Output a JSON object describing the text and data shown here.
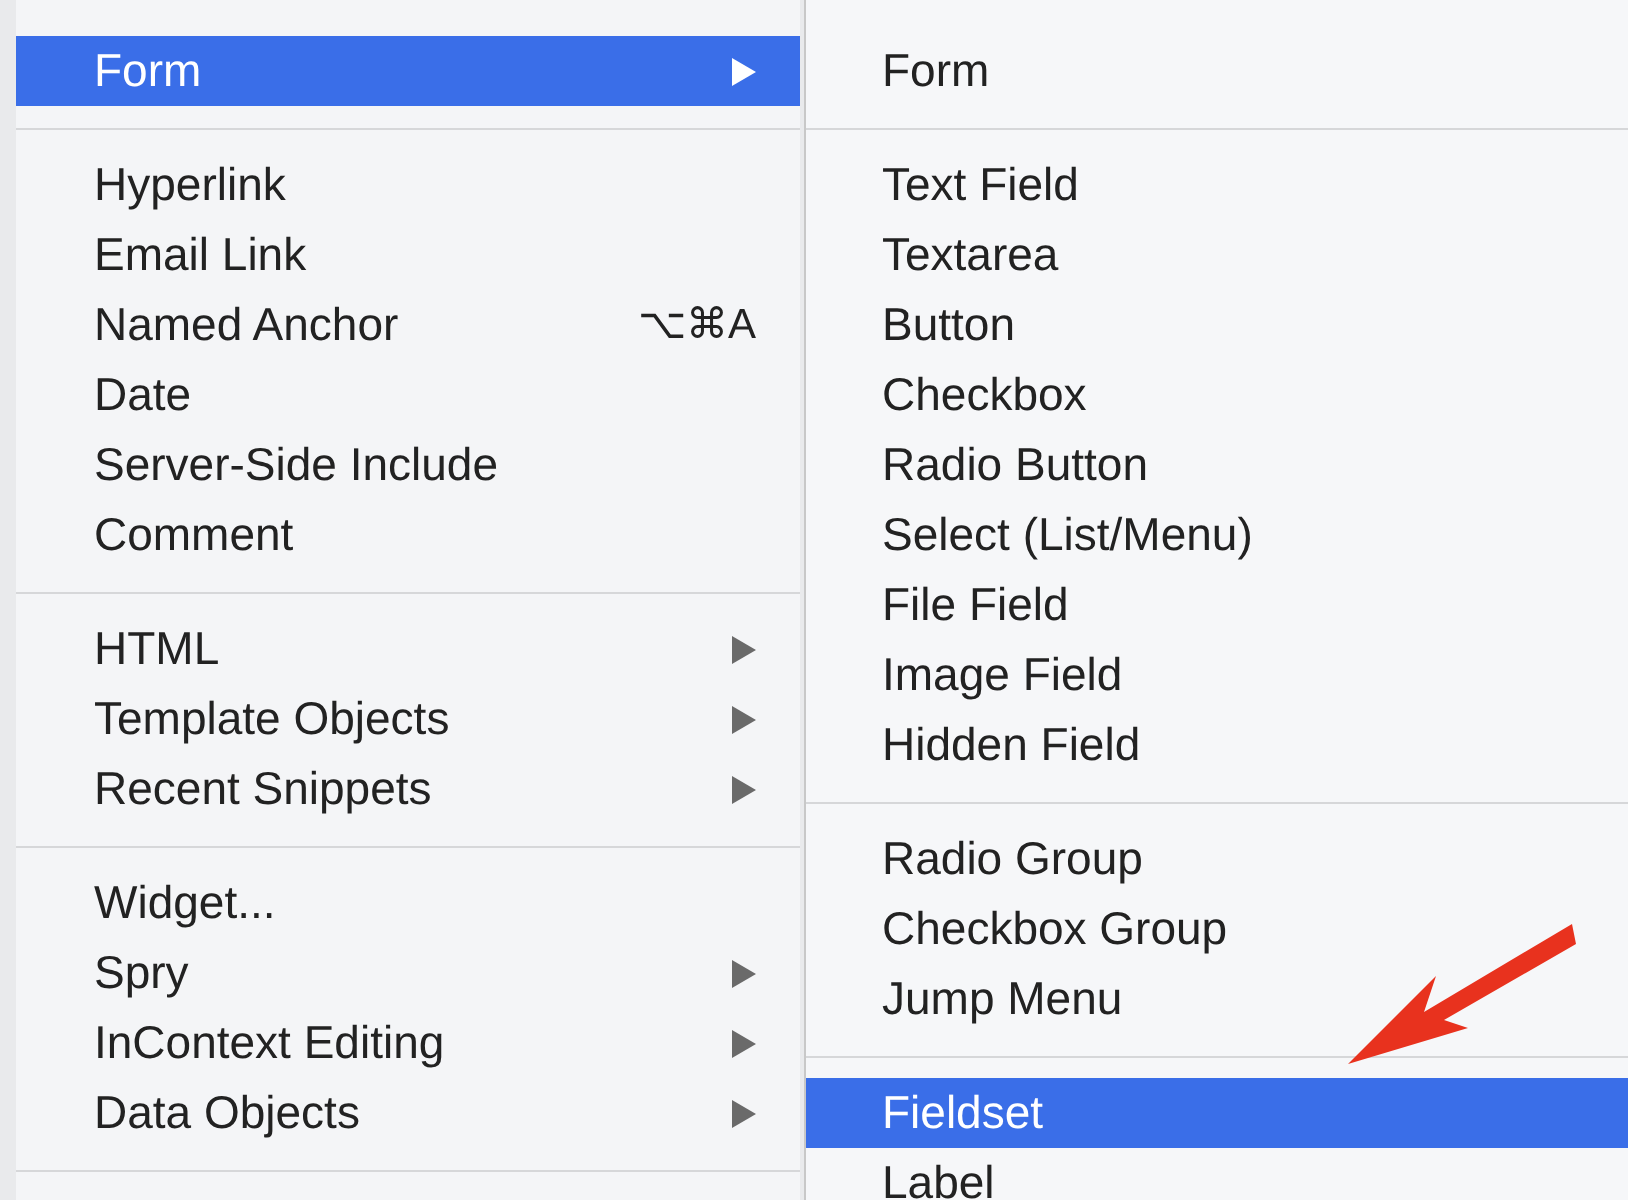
{
  "menu": {
    "items": [
      {
        "kind": "item",
        "label": "Form",
        "selected": true,
        "has_submenu": true
      },
      {
        "kind": "separator"
      },
      {
        "kind": "item",
        "label": "Hyperlink",
        "selected": false,
        "has_submenu": false
      },
      {
        "kind": "item",
        "label": "Email Link",
        "selected": false,
        "has_submenu": false
      },
      {
        "kind": "item",
        "label": "Named Anchor",
        "shortcut": "⌥⌘A",
        "selected": false,
        "has_submenu": false
      },
      {
        "kind": "item",
        "label": "Date",
        "selected": false,
        "has_submenu": false
      },
      {
        "kind": "item",
        "label": "Server-Side Include",
        "selected": false,
        "has_submenu": false
      },
      {
        "kind": "item",
        "label": "Comment",
        "selected": false,
        "has_submenu": false
      },
      {
        "kind": "separator"
      },
      {
        "kind": "item",
        "label": "HTML",
        "selected": false,
        "has_submenu": true
      },
      {
        "kind": "item",
        "label": "Template Objects",
        "selected": false,
        "has_submenu": true
      },
      {
        "kind": "item",
        "label": "Recent Snippets",
        "selected": false,
        "has_submenu": true
      },
      {
        "kind": "separator"
      },
      {
        "kind": "item",
        "label": "Widget...",
        "selected": false,
        "has_submenu": false
      },
      {
        "kind": "item",
        "label": "Spry",
        "selected": false,
        "has_submenu": true
      },
      {
        "kind": "item",
        "label": "InContext Editing",
        "selected": false,
        "has_submenu": true
      },
      {
        "kind": "item",
        "label": "Data Objects",
        "selected": false,
        "has_submenu": true
      },
      {
        "kind": "separator"
      }
    ]
  },
  "submenu": {
    "items": [
      {
        "kind": "item",
        "label": "Form",
        "selected": false
      },
      {
        "kind": "separator"
      },
      {
        "kind": "item",
        "label": "Text Field",
        "selected": false
      },
      {
        "kind": "item",
        "label": "Textarea",
        "selected": false
      },
      {
        "kind": "item",
        "label": "Button",
        "selected": false
      },
      {
        "kind": "item",
        "label": "Checkbox",
        "selected": false
      },
      {
        "kind": "item",
        "label": "Radio Button",
        "selected": false
      },
      {
        "kind": "item",
        "label": "Select (List/Menu)",
        "selected": false
      },
      {
        "kind": "item",
        "label": "File Field",
        "selected": false
      },
      {
        "kind": "item",
        "label": "Image Field",
        "selected": false
      },
      {
        "kind": "item",
        "label": "Hidden Field",
        "selected": false
      },
      {
        "kind": "separator"
      },
      {
        "kind": "item",
        "label": "Radio Group",
        "selected": false
      },
      {
        "kind": "item",
        "label": "Checkbox Group",
        "selected": false
      },
      {
        "kind": "item",
        "label": "Jump Menu",
        "selected": false
      },
      {
        "kind": "separator"
      },
      {
        "kind": "item",
        "label": "Fieldset",
        "selected": true
      },
      {
        "kind": "item",
        "label": "Label",
        "selected": false
      }
    ]
  }
}
